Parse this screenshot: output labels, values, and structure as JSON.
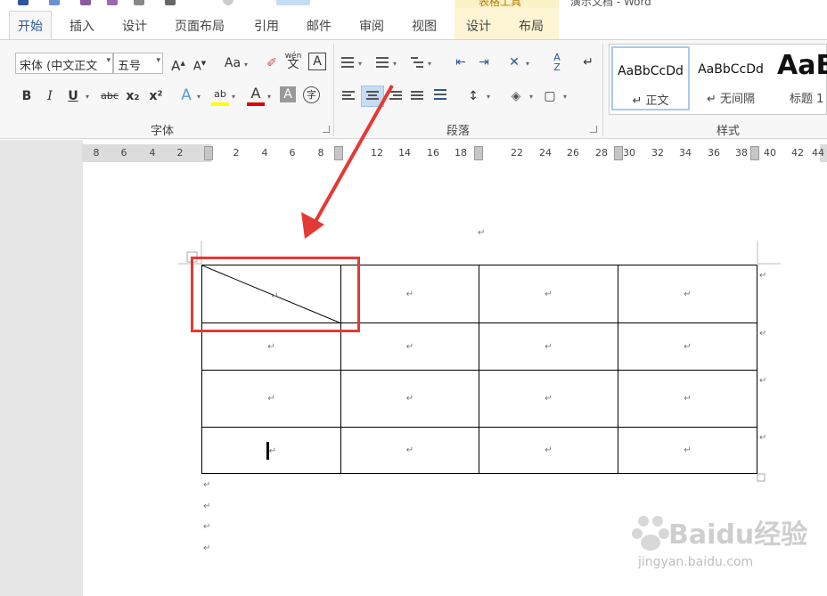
{
  "title_bar": {
    "context_tab_group": "表格工具",
    "document_title": "演示文档 - Word"
  },
  "tabs": [
    {
      "label": "开始",
      "active": true
    },
    {
      "label": "插入"
    },
    {
      "label": "设计"
    },
    {
      "label": "页面布局"
    },
    {
      "label": "引用"
    },
    {
      "label": "邮件"
    },
    {
      "label": "审阅"
    },
    {
      "label": "视图"
    },
    {
      "label": "设计",
      "contextual": true
    },
    {
      "label": "布局",
      "contextual": true
    }
  ],
  "font_group": {
    "label": "字体",
    "font_name": "宋体 (中文正文",
    "font_size": "五号",
    "grow_font": "A",
    "shrink_font": "A",
    "change_case": "Aa",
    "phonetic_guide": "wén",
    "phonetic_char": "文",
    "char_border": "A",
    "bold": "B",
    "italic": "I",
    "underline": "U",
    "strikethrough": "abc",
    "subscript": "x₂",
    "superscript": "x²",
    "text_effect": "A",
    "highlight": "ab",
    "font_color": "A",
    "char_shading": "A",
    "enclose_char": "字"
  },
  "paragraph_group": {
    "label": "段落"
  },
  "styles_group": {
    "label": "样式",
    "styles": [
      {
        "sample": "AaBbCcDd",
        "name": "↵ 正文",
        "selected": true
      },
      {
        "sample": "AaBbCcDd",
        "name": "↵ 无间隔"
      },
      {
        "sample": "AaB",
        "name": "标题 1"
      }
    ]
  },
  "ruler": {
    "left_labels": [
      "8",
      "6",
      "4",
      "2"
    ],
    "right_labels": [
      "2",
      "4",
      "6",
      "8",
      "12",
      "14",
      "16",
      "18",
      "22",
      "24",
      "26",
      "28",
      "30",
      "32",
      "34",
      "36",
      "38",
      "40",
      "42",
      "44"
    ]
  },
  "document": {
    "paragraph_mark": "↵",
    "table": {
      "rows": 4,
      "cols": 4,
      "diagonal_cell": "row-1-col-1"
    }
  },
  "annotation": {
    "color": "#e53935"
  },
  "watermark": {
    "text": "Baidu经验",
    "url": "jingyan.baidu.com"
  },
  "colors": {
    "accent": "#2b579a",
    "highlight_bar": "#ffff00",
    "font_color_bar": "#e00000"
  }
}
